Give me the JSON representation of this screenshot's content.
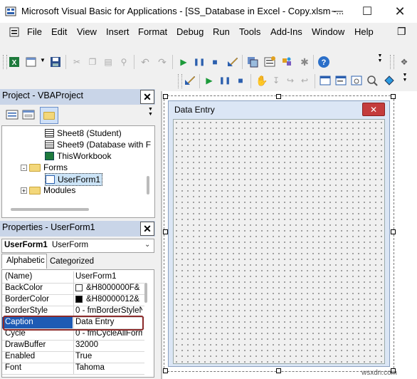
{
  "window": {
    "title": "Microsoft Visual Basic for Applications - [SS_Database in Excel - Copy.xlsm -..."
  },
  "menu": [
    "File",
    "Edit",
    "View",
    "Insert",
    "Format",
    "Debug",
    "Run",
    "Tools",
    "Add-Ins",
    "Window",
    "Help"
  ],
  "project_panel": {
    "title": "Project - VBAProject",
    "tree": [
      {
        "label": "Sheet8 (Student)",
        "icon": "sheet-icon"
      },
      {
        "label": "Sheet9 (Database with F",
        "icon": "sheet-icon"
      },
      {
        "label": "ThisWorkbook",
        "icon": "workbook-icon"
      },
      {
        "label": "Forms",
        "icon": "folder-icon",
        "expander": "-"
      },
      {
        "label": "UserForm1",
        "icon": "form-icon"
      },
      {
        "label": "Modules",
        "icon": "folder-icon",
        "expander": "+"
      }
    ]
  },
  "properties_panel": {
    "title": "Properties - UserForm1",
    "object_name": "UserForm1",
    "object_type": "UserForm",
    "tabs": [
      "Alphabetic",
      "Categorized"
    ],
    "rows": [
      {
        "name": "(Name)",
        "value": "UserForm1"
      },
      {
        "name": "BackColor",
        "value": "&H8000000F&",
        "swatch": "#ffffff"
      },
      {
        "name": "BorderColor",
        "value": "&H80000012&",
        "swatch": "#000000"
      },
      {
        "name": "BorderStyle",
        "value": "0 - fmBorderStyleN"
      },
      {
        "name": "Caption",
        "value": "Data Entry"
      },
      {
        "name": "Cycle",
        "value": "0 - fmCycleAllForm"
      },
      {
        "name": "DrawBuffer",
        "value": "32000"
      },
      {
        "name": "Enabled",
        "value": "True"
      },
      {
        "name": "Font",
        "value": "Tahoma"
      }
    ],
    "highlight_color": "#1e5bb4"
  },
  "form": {
    "caption": "Data Entry"
  },
  "watermark": "wsxdn.com"
}
